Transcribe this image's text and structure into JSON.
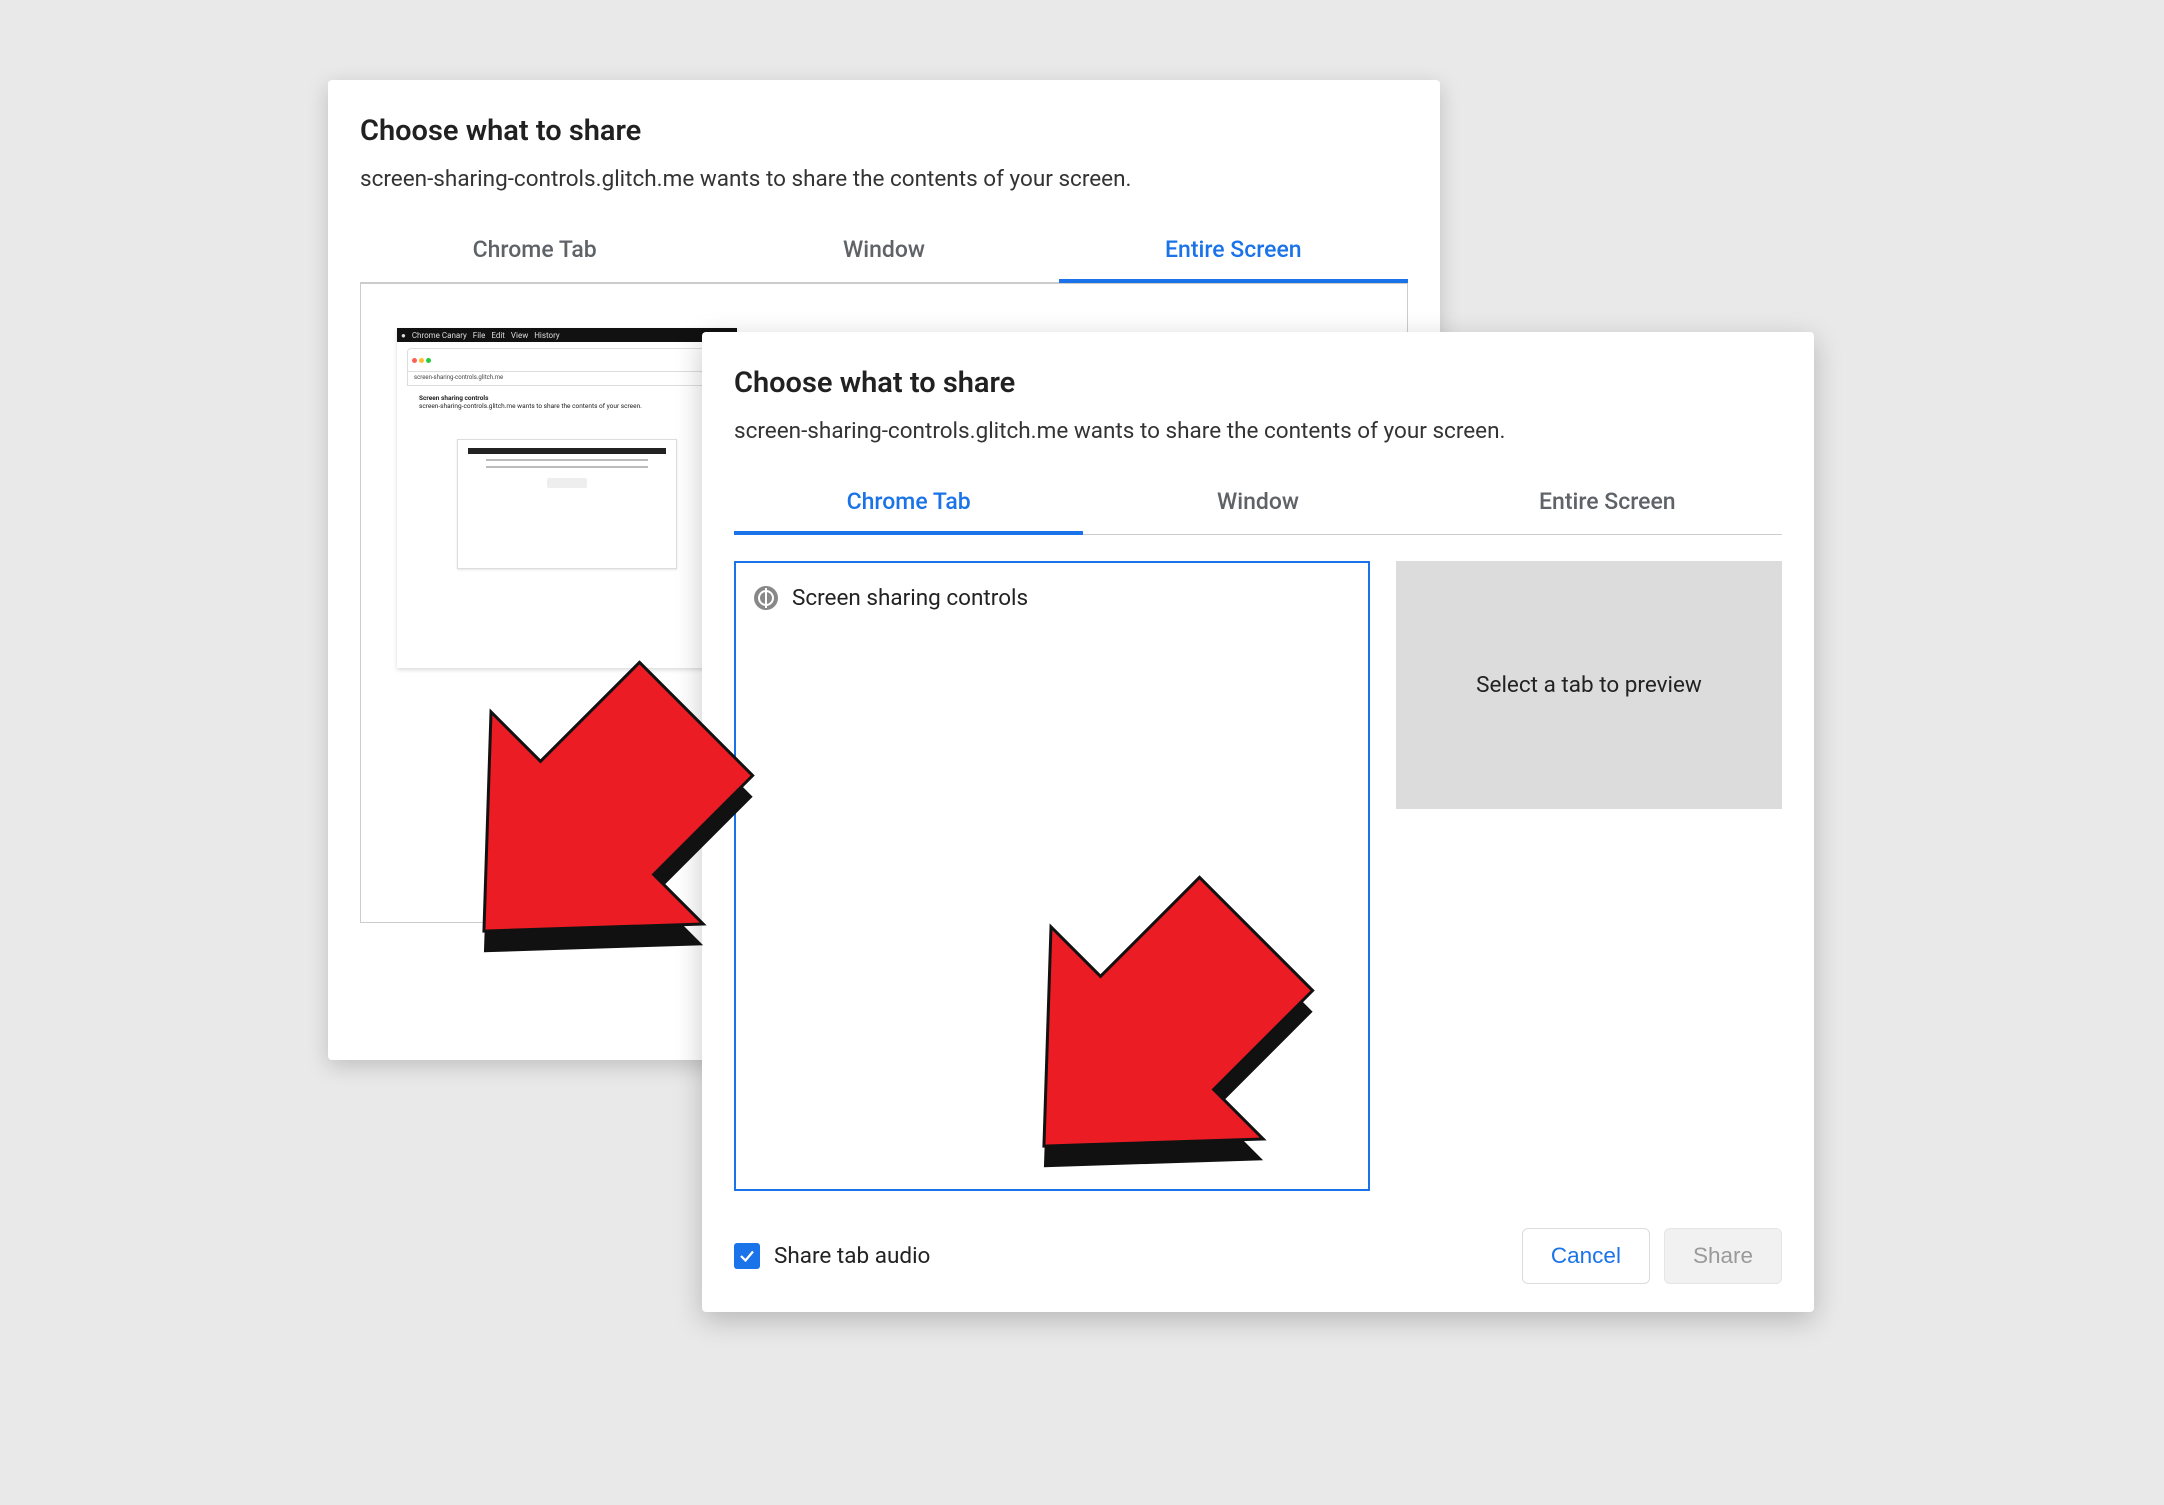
{
  "back_dialog": {
    "title": "Choose what to share",
    "subtitle": "screen-sharing-controls.glitch.me wants to share the contents of your screen.",
    "tabs": {
      "chrome_tab": "Chrome Tab",
      "window": "Window",
      "entire_screen": "Entire Screen"
    },
    "active_tab": "entire_screen"
  },
  "front_dialog": {
    "title": "Choose what to share",
    "subtitle": "screen-sharing-controls.glitch.me wants to share the contents of your screen.",
    "tabs": {
      "chrome_tab": "Chrome Tab",
      "window": "Window",
      "entire_screen": "Entire Screen"
    },
    "active_tab": "chrome_tab",
    "tab_items": [
      {
        "icon": "globe-icon",
        "label": "Screen sharing controls"
      }
    ],
    "preview_placeholder": "Select a tab to preview",
    "share_audio_label": "Share tab audio",
    "share_audio_checked": true,
    "cancel_label": "Cancel",
    "share_label": "Share"
  }
}
